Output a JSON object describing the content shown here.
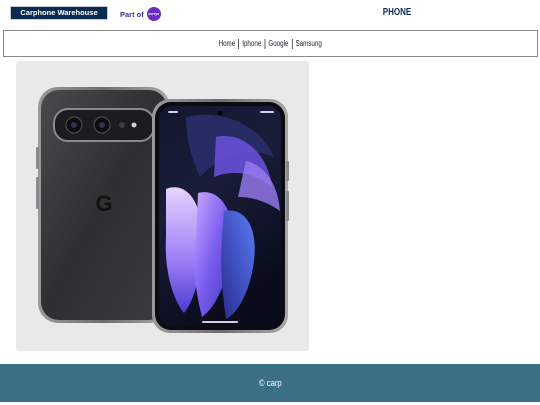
{
  "header": {
    "logo_text": "Carphone Warehouse",
    "partner_prefix": "Part of",
    "partner_badge": "currys",
    "page_heading": "PHONE"
  },
  "nav": {
    "links": [
      "Home",
      "Iphone",
      "Google",
      "Samsung"
    ]
  },
  "product": {
    "image_alt": "google-pixel-phone-image",
    "logo_letter": "G"
  },
  "footer": {
    "text": "© carp"
  },
  "colors": {
    "logo_bg": "#0a2a52",
    "partner_purple": "#6b2cc4",
    "footer_bg": "#3b6f86",
    "nav_border": "#8a8a8a"
  }
}
